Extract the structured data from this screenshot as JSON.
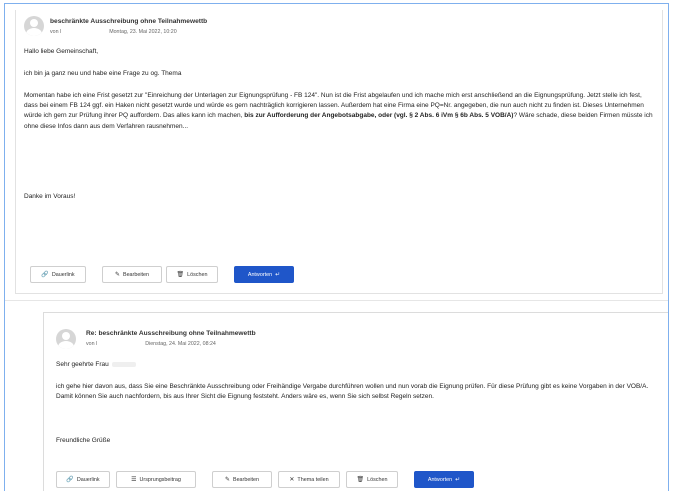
{
  "post1": {
    "title": "beschränkte Ausschreibung ohne Teilnahmewettb",
    "author_prefix": "von l",
    "date": "Montag, 23. Mai 2022, 10:20",
    "greeting": "Hallo liebe Gemeinschaft,",
    "intro": "ich bin ja ganz neu und habe eine Frage zu og. Thema",
    "body_before_bold": "Momentan habe ich eine Frist gesetzt zur \"Einreichung der Unterlagen zur Eignungsprüfung - FB 124\". Nun ist die Frist abgelaufen und ich mache mich erst anschließend an die Eignungsprüfung. Jetzt stelle ich fest, dass bei einem FB 124 ggf. ein Haken nicht gesetzt wurde und würde es gern nachträglich korrigieren lassen. Außerdem hat eine Firma eine PQ=Nr. angegeben, die nun auch nicht zu finden ist. Dieses Unternehmen würde ich gern zur Prüfung ihrer PQ auffordern. Das alles kann ich machen, ",
    "body_bold": "bis zur Aufforderung der Angebotsabgabe, oder (vgl. § 2 Abs. 6 iVm § 6b Abs. 5 VOB/A)",
    "body_after_bold": "? Wäre schade, diese beiden Firmen müsste ich ohne diese Infos dann aus dem Verfahren rausnehmen...",
    "closing": "Danke im Voraus!",
    "buttons": {
      "permalink": "Dauerlink",
      "edit": "Bearbeiten",
      "delete": "Löschen",
      "reply": "Antworten"
    }
  },
  "post2": {
    "title": "Re: beschränkte Ausschreibung ohne Teilnahmewettb",
    "author_prefix": "von l",
    "date": "Dienstag, 24. Mai 2022, 08:24",
    "salutation": "Sehr geehrte Frau",
    "body": "ich gehe hier davon aus, dass Sie eine Beschränkte Ausschreibung oder Freihändige Vergabe durchführen wollen und nun vorab die Eignung prüfen. Für diese Prüfung gibt es keine Vorgaben in der VOB/A. Damit können Sie auch nachfordern, bis aus Ihrer Sicht die Eignung feststeht. Anders wäre es, wenn Sie sich selbst Regeln setzen.",
    "signoff": "Freundliche Grüße",
    "buttons": {
      "permalink": "Dauerlink",
      "parent": "Ursprungsbeitrag",
      "edit": "Bearbeiten",
      "split": "Thema teilen",
      "delete": "Löschen",
      "reply": "Antworten"
    }
  },
  "icons": {
    "permalink": "link-icon",
    "parent": "list-icon",
    "edit": "pencil-icon",
    "split": "x-icon",
    "delete": "trash-icon",
    "reply": "reply-arrow-icon"
  },
  "colors": {
    "primary": "#1f56c9",
    "frame": "#7fb0ee"
  }
}
